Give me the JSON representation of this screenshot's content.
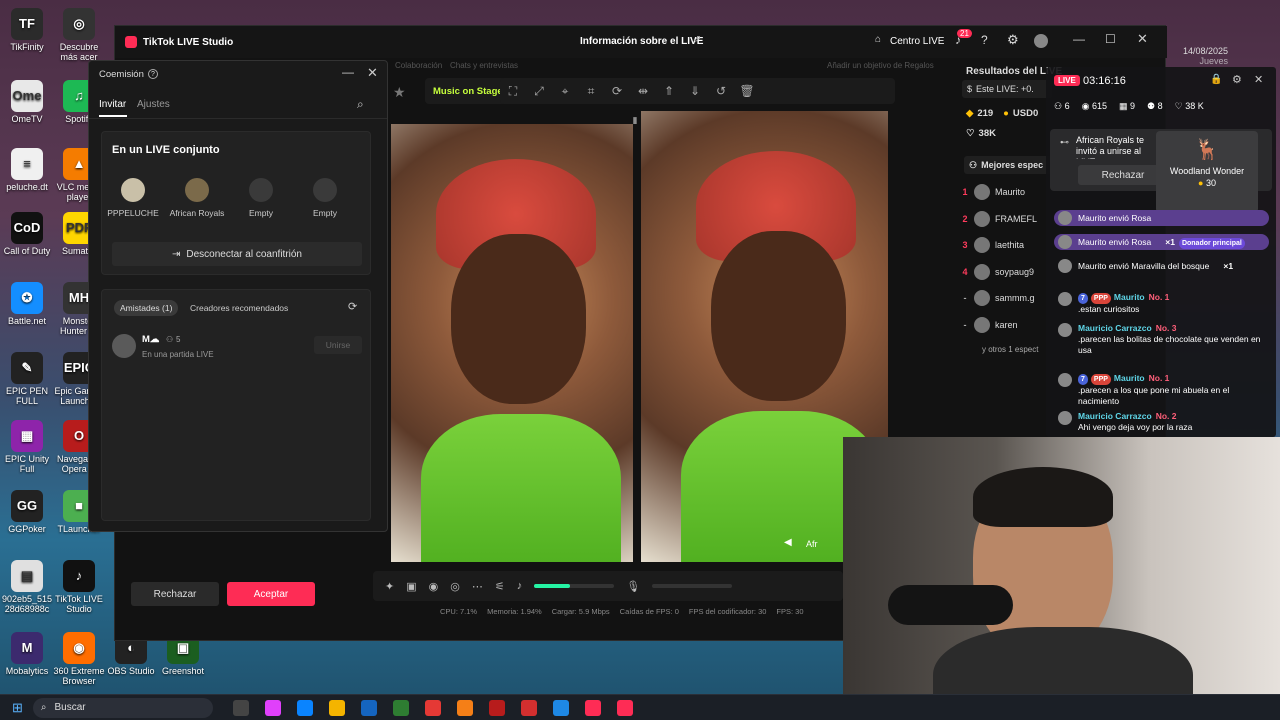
{
  "desktop": {
    "icons": [
      {
        "label": "TikFinity",
        "glyph": "TF",
        "color": "#2b2b2b"
      },
      {
        "label": "Descubre más acer",
        "glyph": "◎",
        "color": "#333"
      },
      {
        "label": "OmeTV",
        "glyph": "Ome",
        "color": "#e8e8e8"
      },
      {
        "label": "Spotify",
        "glyph": "♫",
        "color": "#1db954"
      },
      {
        "label": "peluche.dt",
        "glyph": "≡",
        "color": "#f0f0f0"
      },
      {
        "label": "VLC media player",
        "glyph": "▲",
        "color": "#f57c00"
      },
      {
        "label": "Call of Duty",
        "glyph": "CoD",
        "color": "#111"
      },
      {
        "label": "Sumatra",
        "glyph": "PDF",
        "color": "#ffd600"
      },
      {
        "label": "Battle.net",
        "glyph": "✪",
        "color": "#148eff"
      },
      {
        "label": "Monster Hunter W",
        "glyph": "MH",
        "color": "#333"
      },
      {
        "label": "EPIC PEN FULL",
        "glyph": "✎",
        "color": "#222"
      },
      {
        "label": "Epic Games Launcher",
        "glyph": "EPIC",
        "color": "#222"
      },
      {
        "label": "EPIC Unity Full",
        "glyph": "▦",
        "color": "#8e24aa"
      },
      {
        "label": "Navegador Opera G",
        "glyph": "O",
        "color": "#b71c1c"
      },
      {
        "label": "GGPoker",
        "glyph": "GG",
        "color": "#222"
      },
      {
        "label": "TLauncher",
        "glyph": "■",
        "color": "#4caf50"
      },
      {
        "label": "902eb5_515 28d68988c",
        "glyph": "▤",
        "color": "#e0e0e0"
      },
      {
        "label": "TikTok LIVE Studio",
        "glyph": "♪",
        "color": "#111"
      },
      {
        "label": "Mobalytics",
        "glyph": "M",
        "color": "#3c2a6e"
      },
      {
        "label": "360 Extreme Browser",
        "glyph": "◉",
        "color": "#ff6d00"
      },
      {
        "label": "OBS Studio",
        "glyph": "◐",
        "color": "#222"
      },
      {
        "label": "Greenshot",
        "glyph": "▣",
        "color": "#1b5e20"
      }
    ],
    "date_fragment": "14/08/2025",
    "day_fragment": "Jueves"
  },
  "taskbar": {
    "search_label": "Buscar",
    "apps": [
      "start-icon",
      "task-view-icon",
      "copilot-icon",
      "edge-icon",
      "folder-icon",
      "store-icon",
      "app-icon",
      "chrome-icon",
      "files-icon",
      "record-icon",
      "opera-icon",
      "app2-icon",
      "tiktok-icon",
      "tiktok-live-icon"
    ]
  },
  "studio": {
    "app_title": "TikTok LIVE Studio",
    "center_title": "Información sobre el LIVE",
    "centro_live": "Centro LIVE",
    "notif_count": "21",
    "bg_tabs": [
      "Colaboración",
      "Chats y entrevistas"
    ],
    "bg_goal": "Añadir un objetivo de Regalos",
    "music_on_stage": "Music on Stage",
    "controls_volume_pct": 45,
    "status": {
      "cpu": "CPU: 7.1%",
      "mem": "Memoria: 1.94%",
      "load": "Cargar: 5.9 Mbps",
      "drops": "Caídas de FPS: 0",
      "enc": "FPS del codificador: 30",
      "fps": "FPS: 30"
    },
    "reject_label": "Rechazar",
    "accept_label": "Aceptar",
    "video_caption": "Afr"
  },
  "dialog": {
    "title": "Coemisión",
    "tabs": [
      "Invitar",
      "Ajustes"
    ],
    "active_tab": "Invitar",
    "joint_title": "En un LIVE conjunto",
    "slots": [
      {
        "name": "PPPELUCHE",
        "filled": true
      },
      {
        "name": "African Royals",
        "filled": true
      },
      {
        "name": "Empty",
        "filled": false
      },
      {
        "name": "Empty",
        "filled": false
      }
    ],
    "disconnect_label": "Desconectar al coanfitrión",
    "friends_tabs": [
      "Amistades (1)",
      "Creadores recomendados"
    ],
    "friend": {
      "name": "M☁",
      "count": "5",
      "status": "En una partida LIVE",
      "action": "Unirse"
    }
  },
  "results": {
    "title": "Resultados del LIVE",
    "este_live": "Este LIVE: +0.",
    "diamonds": "219",
    "usd": "USD0",
    "likes": "38K",
    "mejores": "Mejores espec",
    "rank": [
      {
        "pos": "1",
        "name": "Maurito"
      },
      {
        "pos": "2",
        "name": "FRAMEFL"
      },
      {
        "pos": "3",
        "name": "laethita"
      },
      {
        "pos": "4",
        "name": "soypaug9"
      },
      {
        "pos": "-",
        "name": "sammm.g"
      },
      {
        "pos": "-",
        "name": "karen"
      }
    ],
    "others": "y otros 1 espect"
  },
  "chat": {
    "live_badge": "LIVE",
    "timer": "03:16:16",
    "stats": [
      {
        "icon": "viewers-icon",
        "value": "6"
      },
      {
        "icon": "eye-icon",
        "value": "615"
      },
      {
        "icon": "gift-icon",
        "value": "9"
      },
      {
        "icon": "people-icon",
        "value": "8"
      },
      {
        "icon": "heart-icon",
        "value": "38 K"
      }
    ],
    "invite_text": "African Royals te invitó a unirse al LIVE",
    "reject": "Rechazar",
    "gift_card": {
      "name": "Woodland Wonder",
      "coins": "30"
    },
    "gift_rows": [
      {
        "text": "Maurito envió Rosa"
      },
      {
        "text": "Maurito envió Rosa",
        "mult": "×1",
        "tag": "Donador principal"
      },
      {
        "text": "Maurito envió Maravilla del bosque",
        "mult": "×1"
      }
    ],
    "messages": [
      {
        "user": "Maurito",
        "level": "7",
        "badge": "PPP",
        "rank": "No. 1",
        "text": ".estan curiositos"
      },
      {
        "user": "Mauricio Carrazco",
        "rank": "No. 3",
        "text": ".parecen las bolitas de chocolate que venden en usa"
      },
      {
        "user": "Maurito",
        "level": "7",
        "badge": "PPP",
        "rank": "No. 1",
        "text": ".parecen a los que pone mi abuela en el nacimiento"
      },
      {
        "user": "Mauricio Carrazco",
        "rank": "No. 2",
        "text": "Ahi vengo deja voy por la raza"
      }
    ]
  }
}
